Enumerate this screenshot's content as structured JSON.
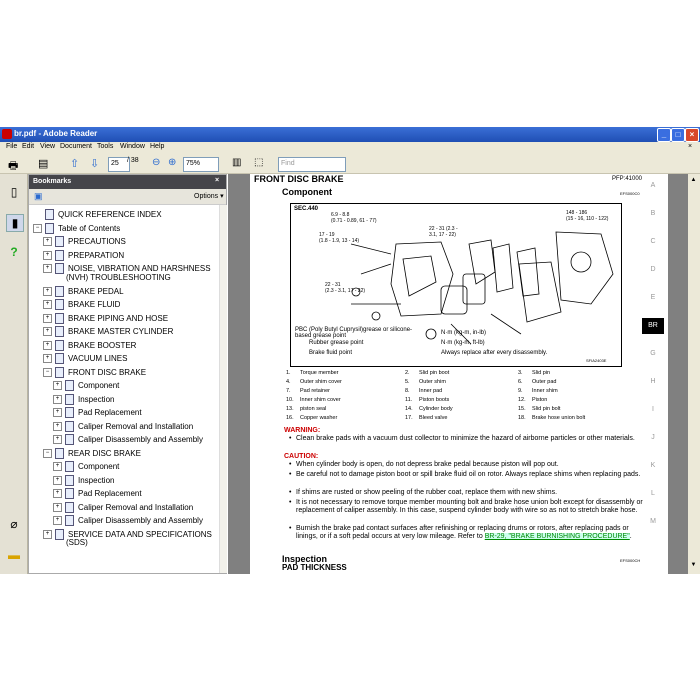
{
  "window": {
    "title": "br.pdf - Adobe Reader",
    "min": "_",
    "max": "□",
    "close": "×",
    "doc_close": "×"
  },
  "menu": [
    "File",
    "Edit",
    "View",
    "Document",
    "Tools",
    "Window",
    "Help"
  ],
  "toolbar": {
    "page_current": "25",
    "page_total": "/ 38",
    "zoom": "75%",
    "find_placeholder": "Find"
  },
  "bookmarks": {
    "title": "Bookmarks",
    "close": "×",
    "options": "Options ▾",
    "items": [
      {
        "label": "QUICK REFERENCE INDEX",
        "level": 0,
        "exp": ""
      },
      {
        "label": "Table of Contents",
        "level": 0,
        "exp": "−"
      },
      {
        "label": "PRECAUTIONS",
        "level": 1,
        "exp": "+"
      },
      {
        "label": "PREPARATION",
        "level": 1,
        "exp": "+"
      },
      {
        "label": "NOISE, VIBRATION AND HARSHNESS",
        "label2": "(NVH) TROUBLESHOOTING",
        "level": 1,
        "exp": "+"
      },
      {
        "label": "BRAKE PEDAL",
        "level": 1,
        "exp": "+"
      },
      {
        "label": "BRAKE FLUID",
        "level": 1,
        "exp": "+"
      },
      {
        "label": "BRAKE PIPING AND HOSE",
        "level": 1,
        "exp": "+"
      },
      {
        "label": "BRAKE MASTER CYLINDER",
        "level": 1,
        "exp": "+"
      },
      {
        "label": "BRAKE BOOSTER",
        "level": 1,
        "exp": "+"
      },
      {
        "label": "VACUUM LINES",
        "level": 1,
        "exp": "+"
      },
      {
        "label": "FRONT DISC BRAKE",
        "level": 1,
        "exp": "−"
      },
      {
        "label": "Component",
        "level": 2,
        "exp": "+"
      },
      {
        "label": "Inspection",
        "level": 2,
        "exp": "+"
      },
      {
        "label": "Pad Replacement",
        "level": 2,
        "exp": "+"
      },
      {
        "label": "Caliper Removal and Installation",
        "level": 2,
        "exp": "+"
      },
      {
        "label": "Caliper Disassembly and Assembly",
        "level": 2,
        "exp": "+"
      },
      {
        "label": "REAR DISC BRAKE",
        "level": 1,
        "exp": "−"
      },
      {
        "label": "Component",
        "level": 2,
        "exp": "+"
      },
      {
        "label": "Inspection",
        "level": 2,
        "exp": "+"
      },
      {
        "label": "Pad Replacement",
        "level": 2,
        "exp": "+"
      },
      {
        "label": "Caliper Removal and Installation",
        "level": 2,
        "exp": "+"
      },
      {
        "label": "Caliper Disassembly and Assembly",
        "level": 2,
        "exp": "+"
      },
      {
        "label": "SERVICE DATA AND SPECIFICATIONS",
        "label2": "(SDS)",
        "level": 1,
        "exp": "+"
      }
    ]
  },
  "page": {
    "section": "FRONT DISC BRAKE",
    "code": "PFP:41000",
    "heading": "Component",
    "code2": "EFS000C0",
    "sec": "SEC.440",
    "side_tabs": [
      "A",
      "B",
      "C",
      "D",
      "E",
      "BR",
      "G",
      "H",
      "I",
      "J",
      "K",
      "L",
      "M"
    ],
    "torques": [
      "6.9 - 8.8\n(0.71 - 0.89, 61 - 77)",
      "17 - 19\n(1.8 - 1.9, 13 - 14)",
      "22 - 31 (2.3 -\n3.1, 17 - 22)",
      "22 - 31\n(2.3 - 3.1, 17 - 22)",
      "148 - 186\n(15 - 16, 110 - 122)"
    ],
    "legend": [
      "PBC (Poly Butyl Cuprysil)grease or silicone-based grease point",
      "Rubber grease point",
      "Brake fluid point",
      "N·m (kg-m, in-lb)",
      "N·m (kg-m, ft-lb)",
      "Always replace after every disassembly."
    ],
    "fig_code": "SFIA2403E",
    "parts": [
      [
        "1.",
        "Torque member",
        "2.",
        "Slid pin boot",
        "3.",
        "Slid pin"
      ],
      [
        "4.",
        "Outer shim cover",
        "5.",
        "Outer shim",
        "6.",
        "Outer pad"
      ],
      [
        "7.",
        "Pad retainer",
        "8.",
        "Inner pad",
        "9.",
        "Inner shim"
      ],
      [
        "10.",
        "Inner shim cover",
        "11.",
        "Piston boots",
        "12.",
        "Piston"
      ],
      [
        "13.",
        "piston seal",
        "14.",
        "Cylinder body",
        "15.",
        "Slid pin bolt"
      ],
      [
        "16.",
        "Copper washer",
        "17.",
        "Bleed valve",
        "18.",
        "Brake hose union bolt"
      ]
    ],
    "warning_label": "WARNING:",
    "warning_text": "Clean brake pads with a vacuum dust collector to minimize the hazard of airborne particles or other materials.",
    "caution_label": "CAUTION:",
    "cautions": [
      "When cylinder body is open, do not depress brake pedal because piston will pop out.",
      "Be careful not to damage piston boot or spill brake fluid oil on rotor. Always replace shims when replacing pads.",
      "If shims are rusted or show peeling of the rubber coat, replace them with new shims.",
      "It is not necessary to remove torque member mounting bolt and brake hose union bolt except for disassembly or replacement of caliper assembly. In this case, suspend cylinder body with wire so as not to stretch brake hose."
    ],
    "last_caution": "Burnish the brake pad contact surfaces after refinishing or replacing drums or rotors, after replacing pads or linings, or if a soft pedal occurs at very low mileage. Refer to",
    "link_text": "BR-29, \"BRAKE BURNISHING PROCEDURE\"",
    "link_tail": ".",
    "inspection": "Inspection",
    "insp_code": "EFS000CH",
    "pad_thickness": "PAD THICKNESS"
  },
  "colors": {
    "titlebar": "#2a5ccb",
    "warning": "#cc0000",
    "link": "#008800"
  }
}
